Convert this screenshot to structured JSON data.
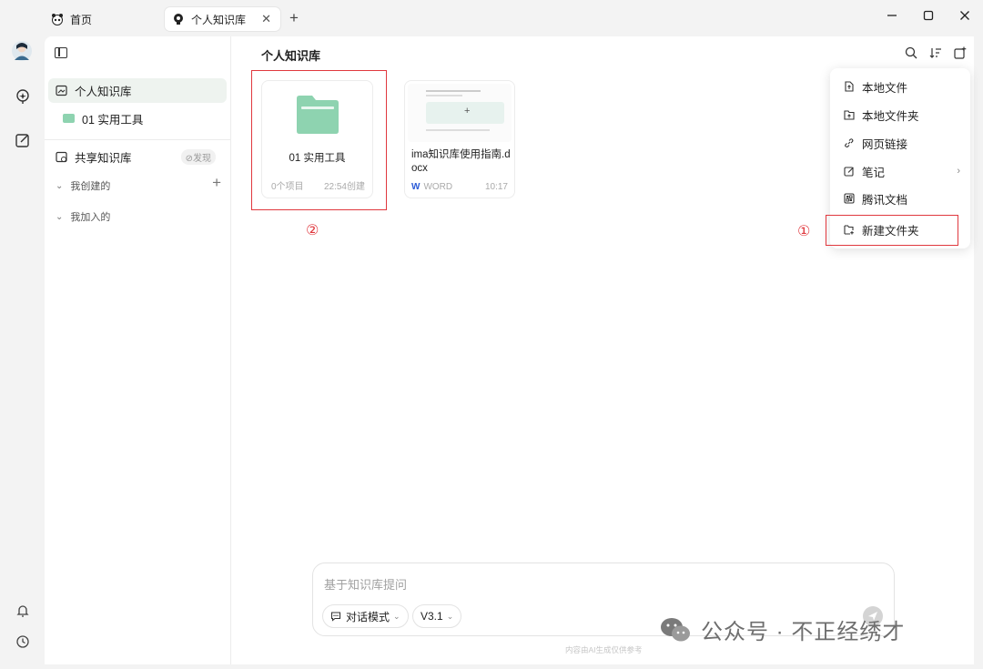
{
  "tabs": {
    "home_label": "首页",
    "active_label": "个人知识库",
    "close_glyph": "✕",
    "new_tab_glyph": "+"
  },
  "window_controls": {
    "minimize": "—",
    "maximize": "☐",
    "close": "✕"
  },
  "sidebar": {
    "personal_kb": "个人知识库",
    "folder_child": "01 实用工具",
    "shared_kb": "共享知识库",
    "discover_badge": "⊘发现",
    "created_by_me": "我创建的",
    "joined": "我加入的",
    "add_glyph": "+"
  },
  "main": {
    "title": "个人知识库"
  },
  "cards": {
    "folder": {
      "name": "01 实用工具",
      "count": "0个项目",
      "created": "22:54创建"
    },
    "doc": {
      "name": "ima知识库使用指南.docx",
      "type": "WORD",
      "time": "10:17"
    }
  },
  "menu": {
    "items": [
      {
        "label": "本地文件",
        "icon": "file-upload-icon"
      },
      {
        "label": "本地文件夹",
        "icon": "folder-upload-icon"
      },
      {
        "label": "网页链接",
        "icon": "link-icon"
      },
      {
        "label": "笔记",
        "icon": "note-icon",
        "has_submenu": true
      },
      {
        "label": "腾讯文档",
        "icon": "tencent-docs-icon"
      },
      {
        "label": "新建文件夹",
        "icon": "new-folder-icon"
      }
    ],
    "submenu_arrow": "›"
  },
  "annotations": {
    "one": "①",
    "two": "②",
    "color": "#e0383e"
  },
  "ask": {
    "placeholder": "基于知识库提问",
    "mode_label": "对话模式",
    "version_label": "V3.1",
    "disclaimer": "内容由AI生成仅供参考"
  },
  "watermark": {
    "text": "公众号 · 不正经绣才"
  },
  "colors": {
    "accent_green": "#8ed3b0",
    "sidebar_active": "#eef3ef",
    "word_blue": "#2b5bd7"
  }
}
